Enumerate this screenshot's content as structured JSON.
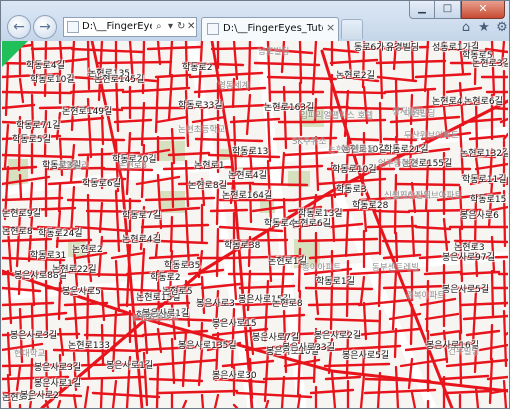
{
  "browser": {
    "address_url": "D:\\__FingerEyes_Tu",
    "tab_title": "D:\\__FingerEyes_Tutorials_...",
    "tab_close": "×",
    "close_glyph": "✕",
    "min_glyph": "▁",
    "max_glyph": "□",
    "back_glyph": "←",
    "forward_glyph": "→",
    "icons": [
      "search-icon",
      "dropdown-icon",
      "refresh-icon",
      "close-icon",
      "home-icon",
      "favorites-star-icon",
      "settings-gear-icon"
    ]
  },
  "map": {
    "road_color": "#e8141c",
    "park_color": "#d6e0be",
    "road_labels": [
      "동로6가길",
      "유경빌딩",
      "성동로1가길",
      "학동로5",
      "학동로4길",
      "논현로135",
      "학동로2",
      "논현로3길",
      "학동로10길",
      "논현로145길",
      "학동로33길",
      "논현로4",
      "논현로2길",
      "학동로71길",
      "논현로163길",
      "학동로3길",
      "논현로6길",
      "논현로149길",
      "학동로13",
      "학동로20길",
      "논현로10길",
      "논현로8길",
      "학동로5길",
      "논현로4길",
      "논현로164길",
      "학동로4",
      "학동로10길",
      "학동로21길",
      "논현로132길",
      "학동로6길",
      "논현로1",
      "학동로7길",
      "논현로9길",
      "학동로13길",
      "논현로155길",
      "학동로24길",
      "학동로3",
      "학동로11길",
      "논현로8",
      "학동로38",
      "학동로15",
      "논현로2",
      "논현로4길",
      "학동로28",
      "봉은사로6",
      "논현로6길",
      "학동로31",
      "학동로35",
      "논현로3",
      "봉은사로88길",
      "학동로2",
      "논현로1길",
      "봉은사로97길",
      "논현로22길",
      "학동로1길",
      "논현로15길",
      "봉은사로5",
      "논현로5",
      "봉은사로3",
      "봉은사로15길",
      "봉은사로5길",
      "논현로8",
      "학동로30",
      "봉은사로15",
      "봉은사로3길",
      "봉은사로1길",
      "논현로133",
      "봉은사로135길",
      "봉은사로3길",
      "봉은사로7길",
      "봉은사로10길",
      "봉은사로30",
      "논현로1",
      "봉은사로1길",
      "봉은사로1길",
      "봉은사로2길",
      "봉은사로5길",
      "봉은사로33길",
      "봉은사로16길",
      "봉은사로2"
    ],
    "poi_labels": [
      "남포빌딩",
      "영동세계",
      "논현초등학교",
      "임피리얼팰리스 호텔",
      "성지빌딩",
      "SK주유소",
      "논현아벨바움",
      "대원빌딩",
      "두산위브아파트",
      "언주중학교",
      "논현로8",
      "성일빌라",
      "월드아파트",
      "신성기상산위브아파트",
      "동부센트레빌",
      "동아아파트",
      "경복아파트",
      "현대학교",
      "논현초등학교",
      "건우빌딩"
    ]
  }
}
